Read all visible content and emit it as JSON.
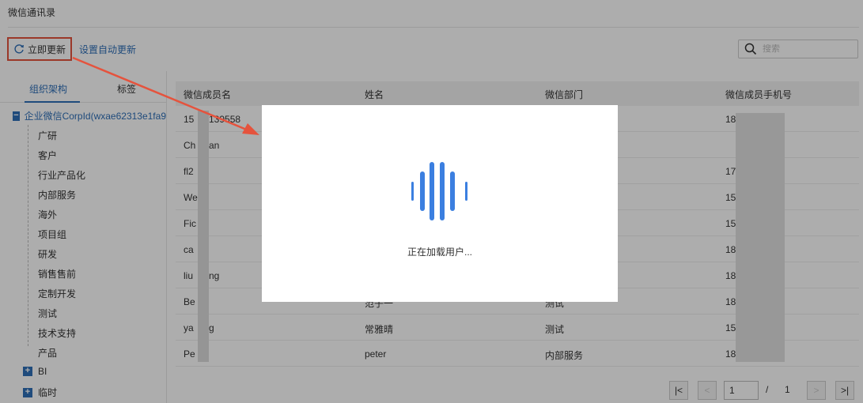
{
  "page": {
    "title": "微信通讯录"
  },
  "toolbar": {
    "update_now": "立即更新",
    "auto_update": "设置自动更新"
  },
  "search": {
    "placeholder": "搜索"
  },
  "left": {
    "tabs": [
      {
        "label": "组织架构",
        "active": true
      },
      {
        "label": "标签",
        "active": false
      }
    ],
    "root": {
      "label": "企业微信CorpId(wxae62313e1fa9",
      "toggle": "−"
    },
    "children": [
      "广研",
      "客户",
      "行业产品化",
      "内部服务",
      "海外",
      "项目组",
      "研发",
      "销售售前",
      "定制开发",
      "测试",
      "技术支持",
      "产品"
    ],
    "collapsed": [
      {
        "label": "BI",
        "toggle": "+"
      },
      {
        "label": "临时",
        "toggle": "+"
      }
    ]
  },
  "table": {
    "columns": [
      "微信成员名",
      "姓名",
      "微信部门",
      "微信成员手机号"
    ],
    "rows": [
      [
        "15",
        "",
        "",
        "18"
      ],
      [
        "Ch",
        "",
        "",
        ""
      ],
      [
        "fl2",
        "",
        "",
        "17"
      ],
      [
        "We",
        "",
        "",
        "15"
      ],
      [
        "Fic",
        "",
        "",
        "15"
      ],
      [
        "ca",
        "",
        "",
        "18"
      ],
      [
        "liu",
        "",
        "",
        "18"
      ],
      [
        "Be",
        "范子一",
        "测试",
        "18"
      ],
      [
        "ya",
        "常雅晴",
        "测试",
        "15"
      ],
      [
        "Pe",
        "peter",
        "内部服务",
        "18"
      ]
    ],
    "row_suffixes": [
      "139558",
      "an",
      "",
      "",
      "",
      "",
      "ng",
      "",
      "g",
      ""
    ]
  },
  "pagination": {
    "first": "|<",
    "prev": "<",
    "current": "1",
    "separator": "/",
    "total": "1",
    "next": ">",
    "last": ">|"
  },
  "modal": {
    "loading_text": "正在加载用户..."
  },
  "colors": {
    "accent": "#2f6fb7",
    "highlight_red": "#e5533d",
    "spinner_blue": "#3b7fe0"
  }
}
